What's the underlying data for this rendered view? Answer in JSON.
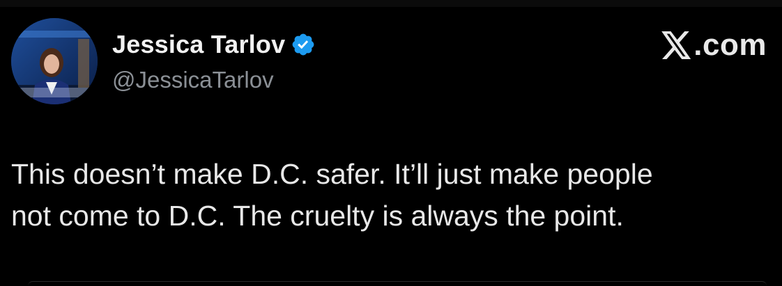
{
  "author": {
    "display_name": "Jessica Tarlov",
    "handle": "@JessicaTarlov",
    "verified": true,
    "avatar_icon": "profile-photo"
  },
  "brand": {
    "icon": "x-logo-icon",
    "text": ".com"
  },
  "tweet": {
    "line1": "This doesn’t make D.C. safer. It’ll just make people",
    "line2": "not come to D.C. The cruelty is always the point."
  },
  "colors": {
    "background": "#000000",
    "verified_badge": "#1d9bf0",
    "handle_text": "#8b9096",
    "primary_text": "#e8e8e8"
  }
}
